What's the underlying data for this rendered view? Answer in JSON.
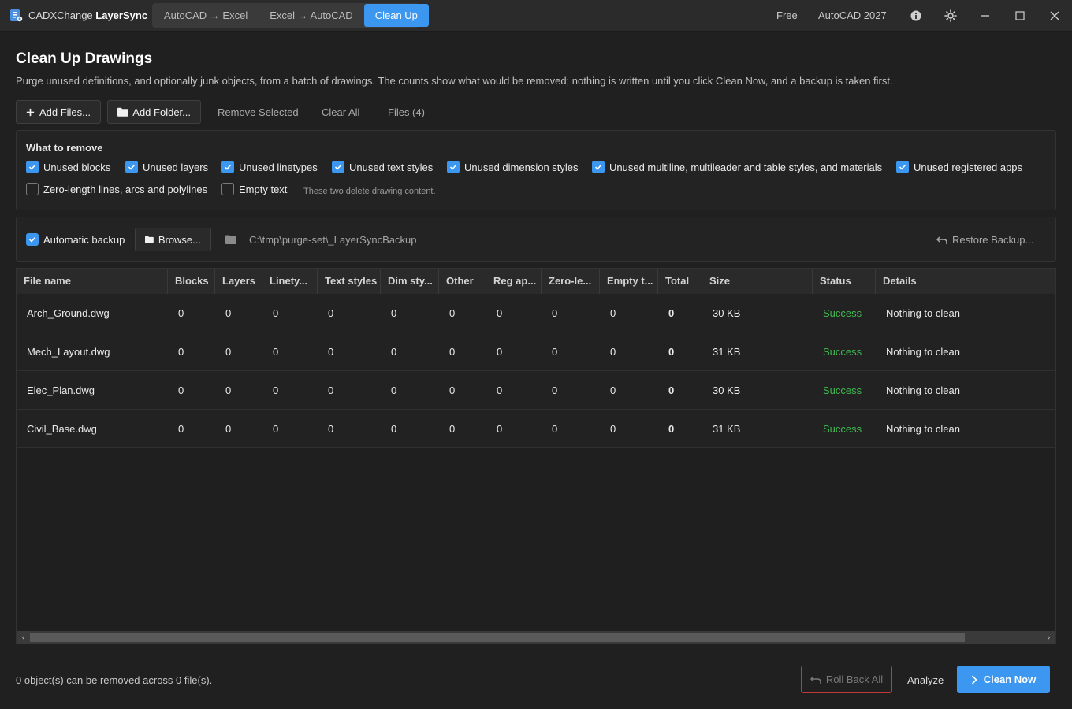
{
  "titlebar": {
    "app_name_prefix": "CADXChange ",
    "app_name_bold": "LayerSync",
    "tabs": [
      {
        "label": "AutoCAD → Excel",
        "active": false
      },
      {
        "label": "Excel → AutoCAD",
        "active": false
      },
      {
        "label": "Clean Up",
        "active": true
      }
    ],
    "plan": "Free",
    "host": "AutoCAD 2027",
    "icons": [
      "info-icon",
      "theme-sun-icon",
      "minimize-icon",
      "maximize-icon",
      "close-icon"
    ]
  },
  "header": {
    "title": "Clean Up Drawings",
    "description": "Purge unused definitions, and optionally junk objects, from a batch of drawings. The counts show what would be removed; nothing is written until you click Clean Now, and a backup is taken first."
  },
  "toolbar": {
    "add_files": "Add Files...",
    "add_folder": "Add Folder...",
    "remove_selected": "Remove Selected",
    "clear_all": "Clear All",
    "files_count": "Files (4)"
  },
  "options": {
    "heading": "What to remove",
    "items": [
      {
        "label": "Unused blocks",
        "checked": true
      },
      {
        "label": "Unused layers",
        "checked": true
      },
      {
        "label": "Unused linetypes",
        "checked": true
      },
      {
        "label": "Unused text styles",
        "checked": true
      },
      {
        "label": "Unused dimension styles",
        "checked": true
      },
      {
        "label": "Unused multiline, multileader and table styles, and materials",
        "checked": true
      },
      {
        "label": "Unused registered apps",
        "checked": true
      },
      {
        "label": "Zero-length lines, arcs and polylines",
        "checked": false
      },
      {
        "label": "Empty text",
        "checked": false
      }
    ],
    "note": "These two delete drawing content."
  },
  "backup": {
    "label": "Automatic backup",
    "checked": true,
    "browse": "Browse...",
    "path": "C:\\tmp\\purge-set\\_LayerSyncBackup",
    "restore": "Restore Backup..."
  },
  "table": {
    "columns": [
      "File name",
      "Blocks",
      "Layers",
      "Linety...",
      "Text styles",
      "Dim sty...",
      "Other",
      "Reg ap...",
      "Zero-le...",
      "Empty t...",
      "Total",
      "Size",
      "Status",
      "Details"
    ],
    "rows": [
      [
        "Arch_Ground.dwg",
        "0",
        "0",
        "0",
        "0",
        "0",
        "0",
        "0",
        "0",
        "0",
        "0",
        "30 KB",
        "Success",
        "Nothing to clean"
      ],
      [
        "Mech_Layout.dwg",
        "0",
        "0",
        "0",
        "0",
        "0",
        "0",
        "0",
        "0",
        "0",
        "0",
        "31 KB",
        "Success",
        "Nothing to clean"
      ],
      [
        "Elec_Plan.dwg",
        "0",
        "0",
        "0",
        "0",
        "0",
        "0",
        "0",
        "0",
        "0",
        "0",
        "30 KB",
        "Success",
        "Nothing to clean"
      ],
      [
        "Civil_Base.dwg",
        "0",
        "0",
        "0",
        "0",
        "0",
        "0",
        "0",
        "0",
        "0",
        "0",
        "31 KB",
        "Success",
        "Nothing to clean"
      ]
    ]
  },
  "footer": {
    "summary": "0 object(s) can be removed across 0 file(s).",
    "rollback": "Roll Back All",
    "analyze": "Analyze",
    "clean_now": "Clean Now"
  },
  "colors": {
    "accent": "#3b97f0",
    "success": "#3fb950",
    "danger_border": "#c0393b",
    "background": "#202020"
  }
}
